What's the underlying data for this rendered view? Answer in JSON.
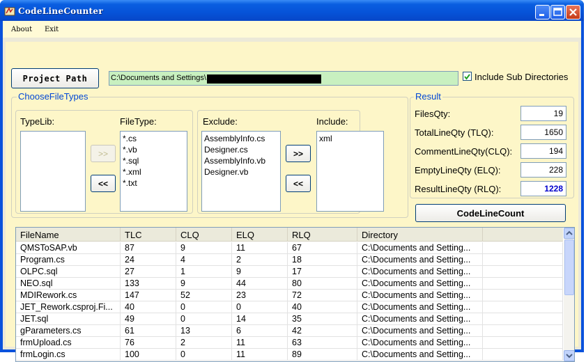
{
  "window": {
    "title": "CodeLineCounter"
  },
  "menu": [
    {
      "label": "About"
    },
    {
      "label": "Exit"
    }
  ],
  "project": {
    "button_label": "Project Path",
    "path_value": "C:\\Documents and Settings\\",
    "include_sub_label": "Include Sub Directories",
    "include_sub_checked": true
  },
  "file_types": {
    "group_title": "ChooseFileTypes",
    "typelib_label": "TypeLib:",
    "typelib_items": [],
    "filetype_label": "FileType:",
    "filetype_items": [
      "*.cs",
      "*.vb",
      "*.sql",
      "*.xml",
      "*.txt"
    ],
    "add_label": ">>",
    "remove_label": "<<",
    "exclude_label": "Exclude:",
    "exclude_items": [
      "AssemblyInfo.cs",
      "Designer.cs",
      "AssemblyInfo.vb",
      "Designer.vb"
    ],
    "include_label": "Include:",
    "include_items": [
      "xml"
    ],
    "add2_label": ">>",
    "remove2_label": "<<"
  },
  "result": {
    "group_title": "Result",
    "files_label": "FilesQty:",
    "files_value": "19",
    "tlq_label": "TotalLineQty (TLQ):",
    "tlq_value": "1650",
    "clq_label": "CommentLineQty(CLQ):",
    "clq_value": "194",
    "elq_label": "EmptyLineQty (ELQ):",
    "elq_value": "228",
    "rlq_label": "ResultLineQty (RLQ):",
    "rlq_value": "1228",
    "rlq_color": "#0000cc",
    "count_button": "CodeLineCount"
  },
  "grid": {
    "columns": [
      "FileName",
      "TLC",
      "CLQ",
      "ELQ",
      "RLQ",
      "Directory"
    ],
    "rows": [
      [
        "QMSToSAP.vb",
        "87",
        "9",
        "11",
        "67",
        "C:\\Documents and Setting..."
      ],
      [
        "Program.cs",
        "24",
        "4",
        "2",
        "18",
        "C:\\Documents and Setting..."
      ],
      [
        "OLPC.sql",
        "27",
        "1",
        "9",
        "17",
        "C:\\Documents and Setting..."
      ],
      [
        "NEO.sql",
        "133",
        "9",
        "44",
        "80",
        "C:\\Documents and Setting..."
      ],
      [
        "MDIRework.cs",
        "147",
        "52",
        "23",
        "72",
        "C:\\Documents and Setting..."
      ],
      [
        "JET_Rework.csproj.Fi...",
        "40",
        "0",
        "0",
        "40",
        "C:\\Documents and Setting..."
      ],
      [
        "JET.sql",
        "49",
        "0",
        "14",
        "35",
        "C:\\Documents and Setting..."
      ],
      [
        "gParameters.cs",
        "61",
        "13",
        "6",
        "42",
        "C:\\Documents and Setting..."
      ],
      [
        "frmUpload.cs",
        "76",
        "2",
        "11",
        "63",
        "C:\\Documents and Setting..."
      ],
      [
        "frmLogin.cs",
        "100",
        "0",
        "11",
        "89",
        "C:\\Documents and Setting..."
      ]
    ]
  },
  "colors": {
    "group_title": "#0046d5",
    "form_bg": "#fdf6c8",
    "path_bg": "#c8f0c0",
    "titlebar": "#0653d8"
  }
}
